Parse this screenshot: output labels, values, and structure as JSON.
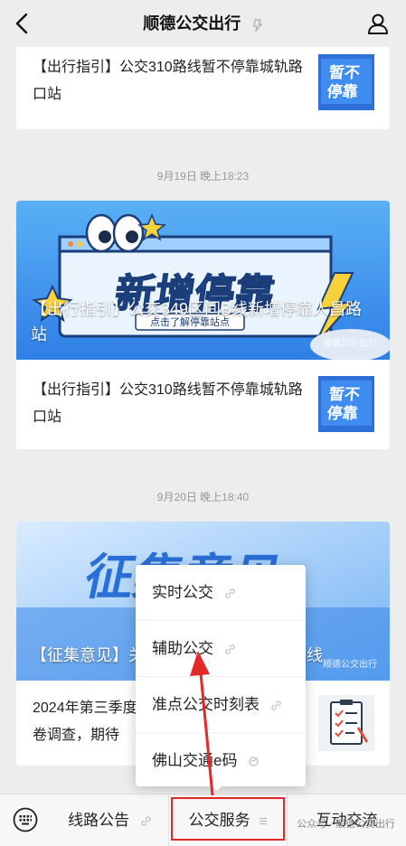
{
  "header": {
    "title": "顺德公交出行"
  },
  "messages": {
    "top_partial": {
      "text": "【出行指引】公交310路线暂不停靠城轨路口站",
      "thumb_lines": [
        "暂不",
        "停靠"
      ]
    },
    "time_1": "9月19日 晚上18:23",
    "card_1": {
      "cover_title": "【出行指引】公交349区间B线新增停靠人昌路站",
      "cover_headline": "新增停靠",
      "cover_sub": "点击了解停靠站点",
      "cover_mark": "顺德公交出行",
      "item_text": "【出行指引】公交310路线暂不停靠城轨路口站",
      "thumb_lines": [
        "暂不",
        "停靠"
      ]
    },
    "time_2": "9月20日 晚上18:40",
    "card_2": {
      "cover_title": "【征集意见】关于  等路线及撤销303路线",
      "cover_headline": "征集意见",
      "cover_mark": "顺德公交出行",
      "item_text": "2024年第三季度问卷调查，期待"
    }
  },
  "popup": {
    "items": [
      {
        "label": "实时公交"
      },
      {
        "label": "辅助公交"
      },
      {
        "label": "准点公交时刻表"
      },
      {
        "label": "佛山交通e码"
      }
    ]
  },
  "bottom_bar": {
    "tabs": [
      "线路公告",
      "公交服务",
      "互动交流"
    ],
    "watermark": "公众号 · 顺德公交出行"
  },
  "colors": {
    "highlight": "#e42828",
    "arrow": "#e42828",
    "cover_blue": "#2f7fe6"
  }
}
